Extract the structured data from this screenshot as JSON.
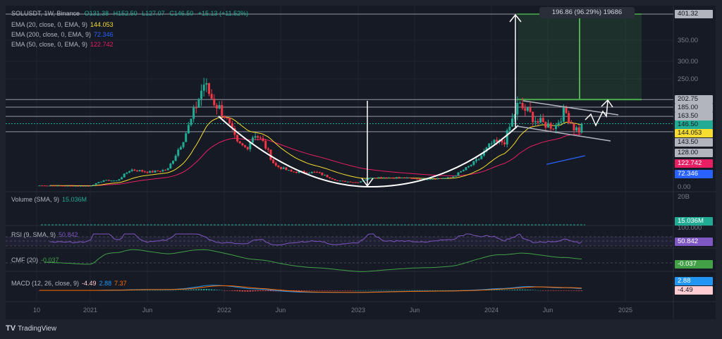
{
  "header": {
    "symbol_line": "SOLUSDT, 1W, Binance",
    "open": "O131.38",
    "high": "H152.50",
    "low": "L127.07",
    "close": "C146.50",
    "change": "+15.13 (+11.52%)"
  },
  "indicators": {
    "ema20": {
      "label": "EMA (20, close, 0, EMA, 9)",
      "value": "144.053",
      "color": "#f7dd2f"
    },
    "ema200": {
      "label": "EMA (200, close, 0, EMA, 9)",
      "value": "72.346",
      "color": "#2962ff"
    },
    "ema50": {
      "label": "EMA (50, close, 0, EMA, 9)",
      "value": "122.742",
      "color": "#e91e63"
    },
    "volume": {
      "label": "Volume (SMA, 9)",
      "value": "15.036M"
    },
    "rsi": {
      "label": "RSI (9, SMA, 9)",
      "value": "50.842"
    },
    "cmf": {
      "label": "CMF (20)",
      "value": "-0.037"
    },
    "macd": {
      "label": "MACD (12, 26, close, 9)",
      "hist": "-4.49",
      "macd": "2.88",
      "signal": "7.37"
    }
  },
  "price_axis": {
    "ticks": [
      "350.00",
      "300.00",
      "250.00",
      "0.00"
    ],
    "labels": [
      {
        "text": "401.32",
        "bg": "#b2b5be"
      },
      {
        "text": "202.75",
        "bg": "#b2b5be"
      },
      {
        "text": "185.00",
        "bg": "#b2b5be"
      },
      {
        "text": "163.50",
        "bg": "#b2b5be"
      },
      {
        "text": "146.50",
        "bg": "#22ab94"
      },
      {
        "text": "144.053",
        "bg": "#f7dd2f"
      },
      {
        "text": "143.50",
        "bg": "#b2b5be"
      },
      {
        "text": "128.00",
        "bg": "#b2b5be"
      },
      {
        "text": "122.742",
        "bg": "#e91e63"
      },
      {
        "text": "72.346",
        "bg": "#2962ff"
      }
    ],
    "volume_tick": "20B",
    "rsi_tick": "100.000",
    "pane_labels": [
      {
        "text": "15.036M",
        "bg": "#22ab94"
      },
      {
        "text": "50.842",
        "bg": "#7e57c2"
      },
      {
        "text": "-0.037",
        "bg": "#43a047"
      },
      {
        "text": "2.88",
        "bg": "#2196f3"
      },
      {
        "text": "-4.49",
        "bg": "#ffcdd2"
      }
    ]
  },
  "time_axis": [
    "10",
    "2021",
    "Jun",
    "2022",
    "Jun",
    "2023",
    "Jun",
    "2024",
    "Jun",
    "2025"
  ],
  "measure_label": "196.86 (96.29%) 19686",
  "brand": "TradingView",
  "colors": {
    "up": "#22ab94",
    "down": "#f23645",
    "bg": "#161a25"
  },
  "chart_data": {
    "type": "candlestick",
    "title": "SOLUSDT, 1W, Binance",
    "ylim": [
      0,
      401.32
    ],
    "x_range": [
      "2020-08",
      "2025-06"
    ],
    "price_path_approx": [
      [
        2020.62,
        3
      ],
      [
        2020.9,
        2
      ],
      [
        2021.0,
        2
      ],
      [
        2021.1,
        15
      ],
      [
        2021.2,
        14
      ],
      [
        2021.3,
        40
      ],
      [
        2021.45,
        34
      ],
      [
        2021.58,
        40
      ],
      [
        2021.68,
        100
      ],
      [
        2021.75,
        150
      ],
      [
        2021.85,
        240
      ],
      [
        2021.92,
        200
      ],
      [
        2022.0,
        170
      ],
      [
        2022.1,
        100
      ],
      [
        2022.17,
        90
      ],
      [
        2022.23,
        125
      ],
      [
        2022.3,
        100
      ],
      [
        2022.38,
        50
      ],
      [
        2022.5,
        35
      ],
      [
        2022.7,
        33
      ],
      [
        2022.85,
        14
      ],
      [
        2023.0,
        10
      ],
      [
        2023.1,
        22
      ],
      [
        2023.3,
        21
      ],
      [
        2023.5,
        18
      ],
      [
        2023.7,
        21
      ],
      [
        2023.8,
        40
      ],
      [
        2023.9,
        62
      ],
      [
        2024.0,
        100
      ],
      [
        2024.1,
        105
      ],
      [
        2024.2,
        190
      ],
      [
        2024.27,
        175
      ],
      [
        2024.35,
        150
      ],
      [
        2024.48,
        140
      ],
      [
        2024.55,
        178
      ],
      [
        2024.62,
        138
      ],
      [
        2024.66,
        131
      ],
      [
        2024.69,
        146.5
      ]
    ]
  }
}
